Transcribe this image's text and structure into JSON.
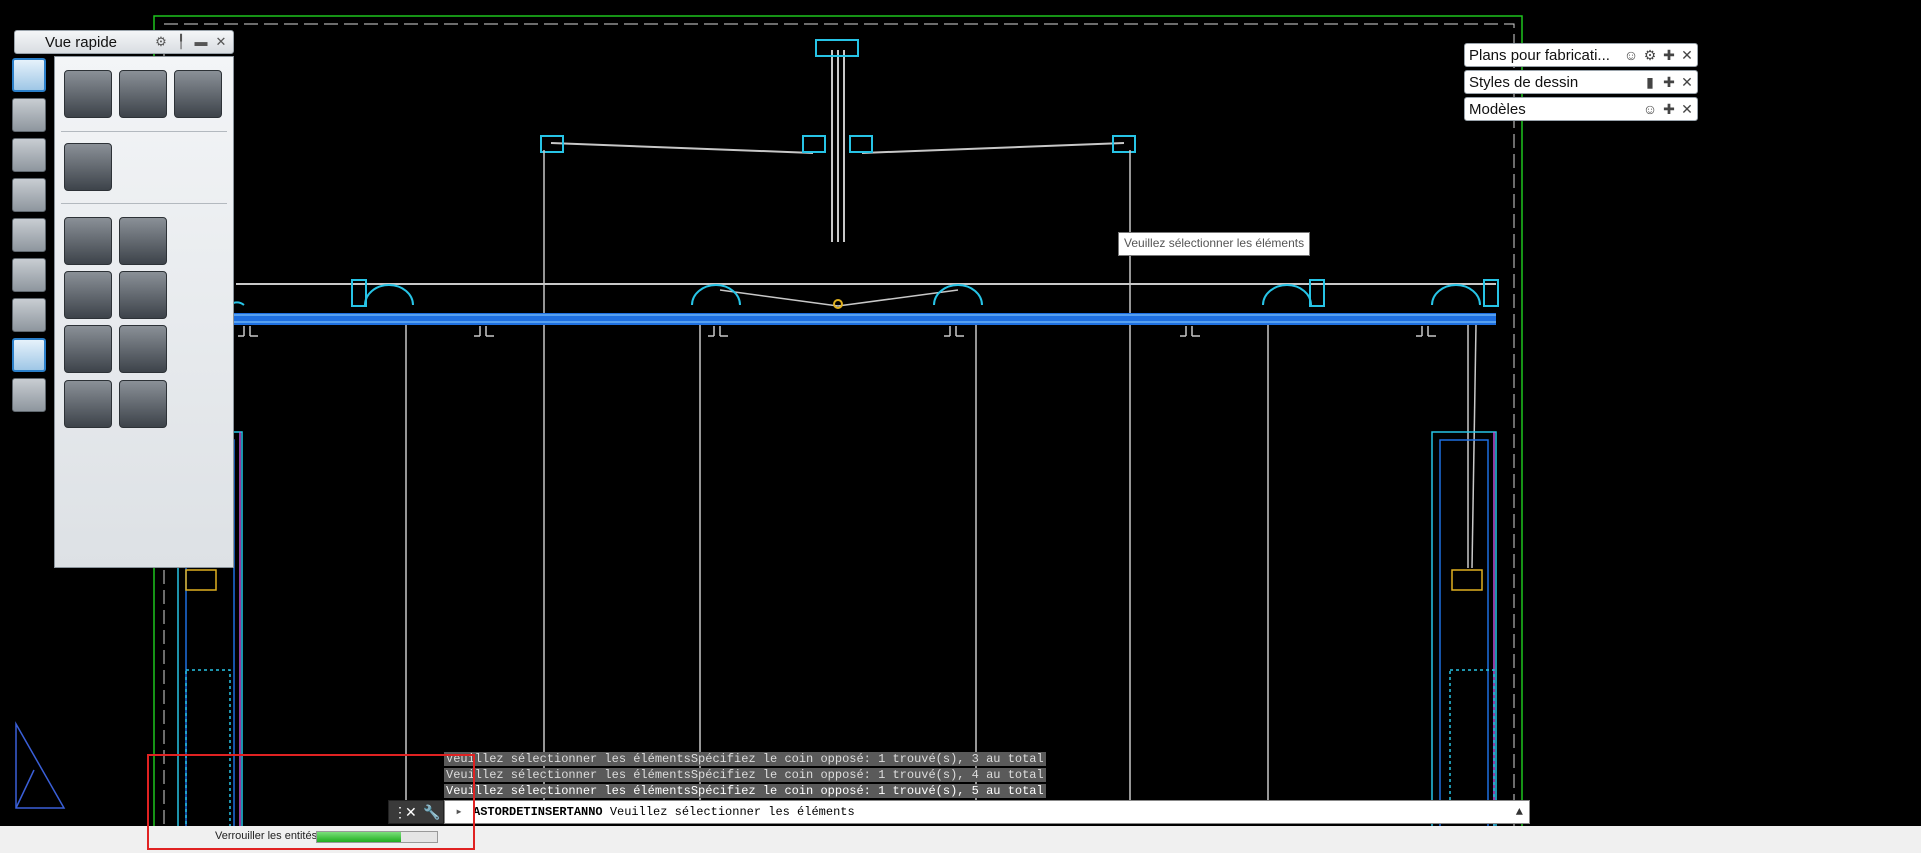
{
  "palette": {
    "title": "Vue rapide",
    "buttons": [
      "beam-button",
      "bent-plate-button",
      "box-button",
      "solid-box-button",
      "frame-button",
      "plate-joint-button",
      "wood-block-button",
      "wood-beam-button",
      "profile-l-button",
      "profile-corner-button",
      "profile-stack-button",
      "profile-rounded-button"
    ]
  },
  "right_panels": [
    {
      "title": "Plans pour fabricati..."
    },
    {
      "title": "Styles de dessin"
    },
    {
      "title": "Modèles"
    }
  ],
  "tooltip": "Veuillez sélectionner les éléments",
  "command_history": [
    "Veuillez sélectionner les élémentsSpécifiez le coin opposé: 1 trouvé(s), 3 au total",
    "Veuillez sélectionner les élémentsSpécifiez le coin opposé: 1 trouvé(s), 4 au total",
    "Veuillez sélectionner les élémentsSpécifiez le coin opposé: 1 trouvé(s), 5 au total"
  ],
  "command_line": {
    "command": "ASTORDETINSERTANNO",
    "prompt": "Veuillez sélectionner les éléments"
  },
  "status": {
    "label": "Verrouiller les entités",
    "progress": 0.7
  },
  "colors": {
    "background": "#000000",
    "beam_blue": "#1e6fe0",
    "cyan": "#27c4e6",
    "border_green": "#1ec41e",
    "grey_line": "#c8c8c8",
    "highlight": "#e02222"
  }
}
